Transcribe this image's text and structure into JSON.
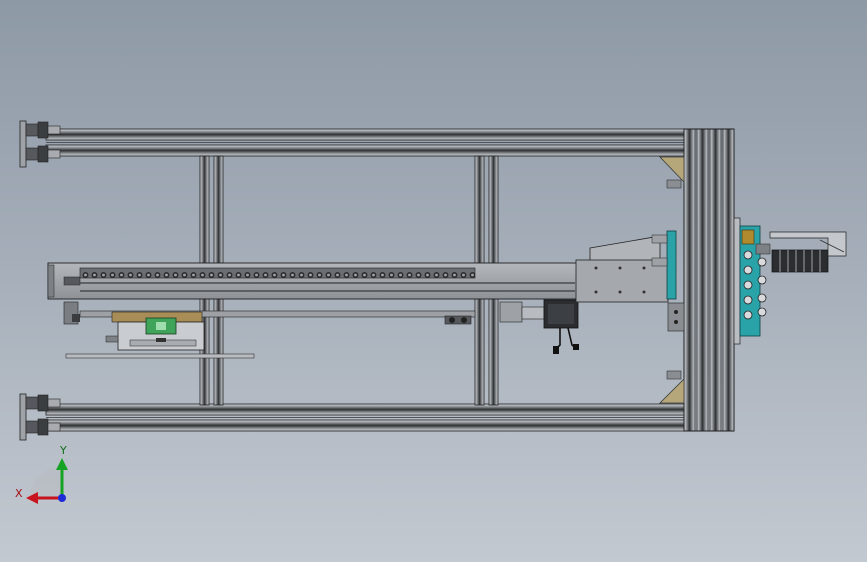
{
  "view": {
    "background_top": "#8e99a6",
    "background_bottom": "#c3c9d1",
    "model_type": "aluminum-profile linear gantry assembly (top view)"
  },
  "triad": {
    "x_label": "X",
    "y_label": "Y",
    "x_color": "#c8141e",
    "y_color": "#16a324",
    "z_color": "#1c2bd6"
  },
  "colors": {
    "profile_dark": "#2e3033",
    "profile_mid": "#6f7377",
    "profile_light": "#c7cbcf",
    "accent_teal": "#2aa3a8",
    "accent_green": "#3fa35a",
    "accent_gold": "#b08a2e"
  }
}
